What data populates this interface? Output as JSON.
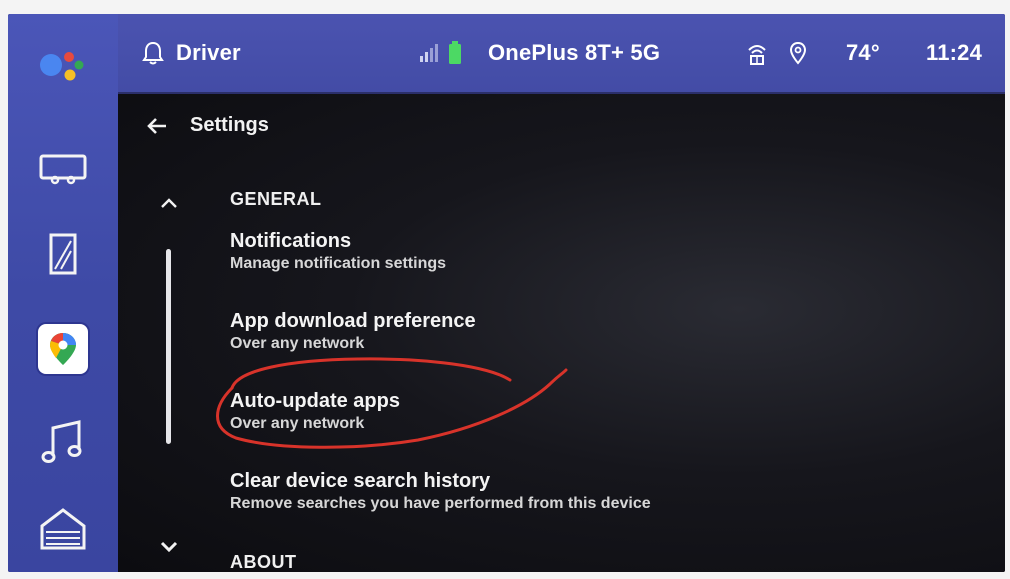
{
  "status_bar": {
    "profile_label": "Driver",
    "device_name": "OnePlus 8T+ 5G",
    "temperature": "74°",
    "time": "11:24"
  },
  "header": {
    "title": "Settings"
  },
  "sections": {
    "general_label": "GENERAL",
    "about_label": "ABOUT"
  },
  "settings_items": [
    {
      "title": "Notifications",
      "subtitle": "Manage notification settings"
    },
    {
      "title": "App download preference",
      "subtitle": "Over any network"
    },
    {
      "title": "Auto-update apps",
      "subtitle": "Over any network"
    },
    {
      "title": "Clear device search history",
      "subtitle": "Remove searches you have performed from this device"
    }
  ],
  "rail": {
    "items": [
      "assistant-icon",
      "vehicle-icon",
      "wallpaper-icon",
      "maps-icon",
      "music-icon",
      "home-icon"
    ]
  },
  "colors": {
    "rail_bg": "#3e4aa6",
    "status_bg": "#4b53b0",
    "battery_green": "#4cd964",
    "annotation_red": "#d8332a"
  }
}
